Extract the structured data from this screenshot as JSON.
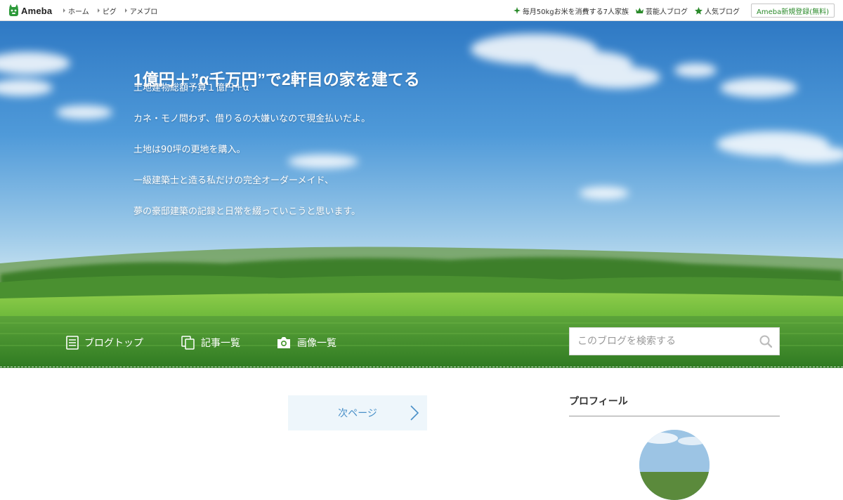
{
  "topbar": {
    "logo": "Ameba",
    "nav": [
      "ホーム",
      "ピグ",
      "アメブロ"
    ],
    "links": [
      {
        "label": "毎月50kgお米を消費する7人家族",
        "icon": "sparkle-icon"
      },
      {
        "label": "芸能人ブログ",
        "icon": "crown-icon"
      },
      {
        "label": "人気ブログ",
        "icon": "star-icon"
      }
    ],
    "register": "Ameba新規登録(無料)"
  },
  "header": {
    "title": "1億円＋”α千万円”で2軒目の家を建てる",
    "description": [
      "土地建物総額予算１億円＋α",
      "カネ・モノ問わず、借りるの大嫌いなので現金払いだよ。",
      "土地は90坪の更地を購入。",
      "一級建築士と造る私だけの完全オーダーメイド、",
      "夢の豪邸建築の記録と日常を綴っていこうと思います。"
    ]
  },
  "nav": {
    "items": [
      {
        "label": "ブログトップ",
        "icon": "blog-top-icon"
      },
      {
        "label": "記事一覧",
        "icon": "article-list-icon"
      },
      {
        "label": "画像一覧",
        "icon": "camera-icon"
      }
    ],
    "search_placeholder": "このブログを検索する"
  },
  "main": {
    "next_page": "次ページ"
  },
  "sidebar": {
    "profile_heading": "プロフィール"
  },
  "colors": {
    "brand_green": "#2a8a2a",
    "link_blue": "#4a90c8",
    "next_bg": "#eef6fb"
  }
}
